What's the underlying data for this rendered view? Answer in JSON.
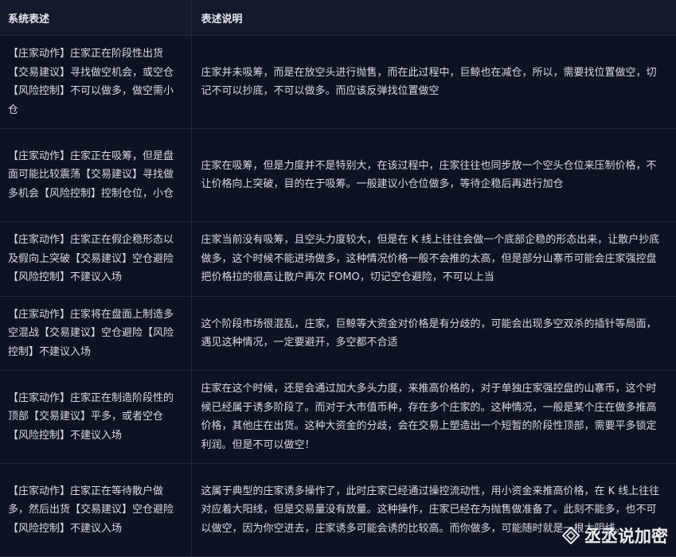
{
  "table": {
    "headers": [
      "系统表述",
      "表述说明"
    ],
    "rows": [
      {
        "statement": "【庄家动作】庄家正在阶段性出货【交易建议】寻找做空机会，或空仓【风险控制】不可以做多，做空需小仓",
        "explanation": "庄家并未吸筹，而是在放空头进行抛售，而在此过程中，巨鲸也在减仓，所以，需要找位置做空，切记不可以抄底，不可以做多。而应该反弹找位置做空"
      },
      {
        "statement": "【庄家动作】庄家正在吸筹，但是盘面可能比较震荡【交易建议】寻找做多机会【风险控制】控制仓位，小仓",
        "explanation": "庄家在吸筹，但是力度并不是特别大，在该过程中，庄家往往也同步放一个空头仓位来压制价格，不让价格向上突破，目的在于吸筹。一般建议小仓位做多，等待企稳后再进行加仓"
      },
      {
        "statement": "【庄家动作】庄家正在假企稳形态以及假向上突破【交易建议】空仓避险【风险控制】不建议入场",
        "explanation": "庄家当前没有吸筹，且空头力度较大，但是在 K 线上往往会做一个底部企稳的形态出来，让散户抄底做多，这个时候不能进场做多，这种情况价格一般不会推的太高，但是部分山寨币可能会庄家强控盘把价格拉的很高让散户再次 FOMO，切记空仓避险，不可以上当"
      },
      {
        "statement": "【庄家动作】庄家将在盘面上制造多空混战【交易建议】空仓避险【风险控制】不建议入场",
        "explanation": "这个阶段市场很混乱，庄家，巨鲸等大资金对价格是有分歧的，可能会出现多空双杀的插针等局面，遇见这种情况，一定要避开，多空都不合适"
      },
      {
        "statement": "【庄家动作】庄家正在制造阶段性的顶部【交易建议】平多，或者空仓【风险控制】不建议入场",
        "explanation": "庄家在这个时候，还是会通过加大多头力度，来推高价格的，对于单独庄家强控盘的山寨币，这个时候已经属于诱多阶段了。而对于大市值币种，存在多个庄家的。这种情况，一般是某个庄在做多推高价格，其他庄在出货。这种大资金的分歧，会在交易上塑造出一个短暂的阶段性顶部，需要平多锁定利润。但是不可以做空！"
      },
      {
        "statement": "【庄家动作】庄家正在等待散户做多，然后出货【交易建议】空仓避险【风险控制】不建议入场",
        "explanation": "这属于典型的庄家诱多操作了，此时庄家已经通过操控流动性，用小资金来推高价格，在 K 线上往往对应着大阳线，但是交易量没有放量。这种操作，庄家已经在为抛售做准备了。此刻不能多，也不可以做空，因为你空进去，庄家诱多可能会诱的比较高。而你做多，可能随时就是一根大阴线。"
      }
    ]
  },
  "watermark": {
    "text": "丞丞说加密",
    "icon": "diamond-logo-icon"
  }
}
